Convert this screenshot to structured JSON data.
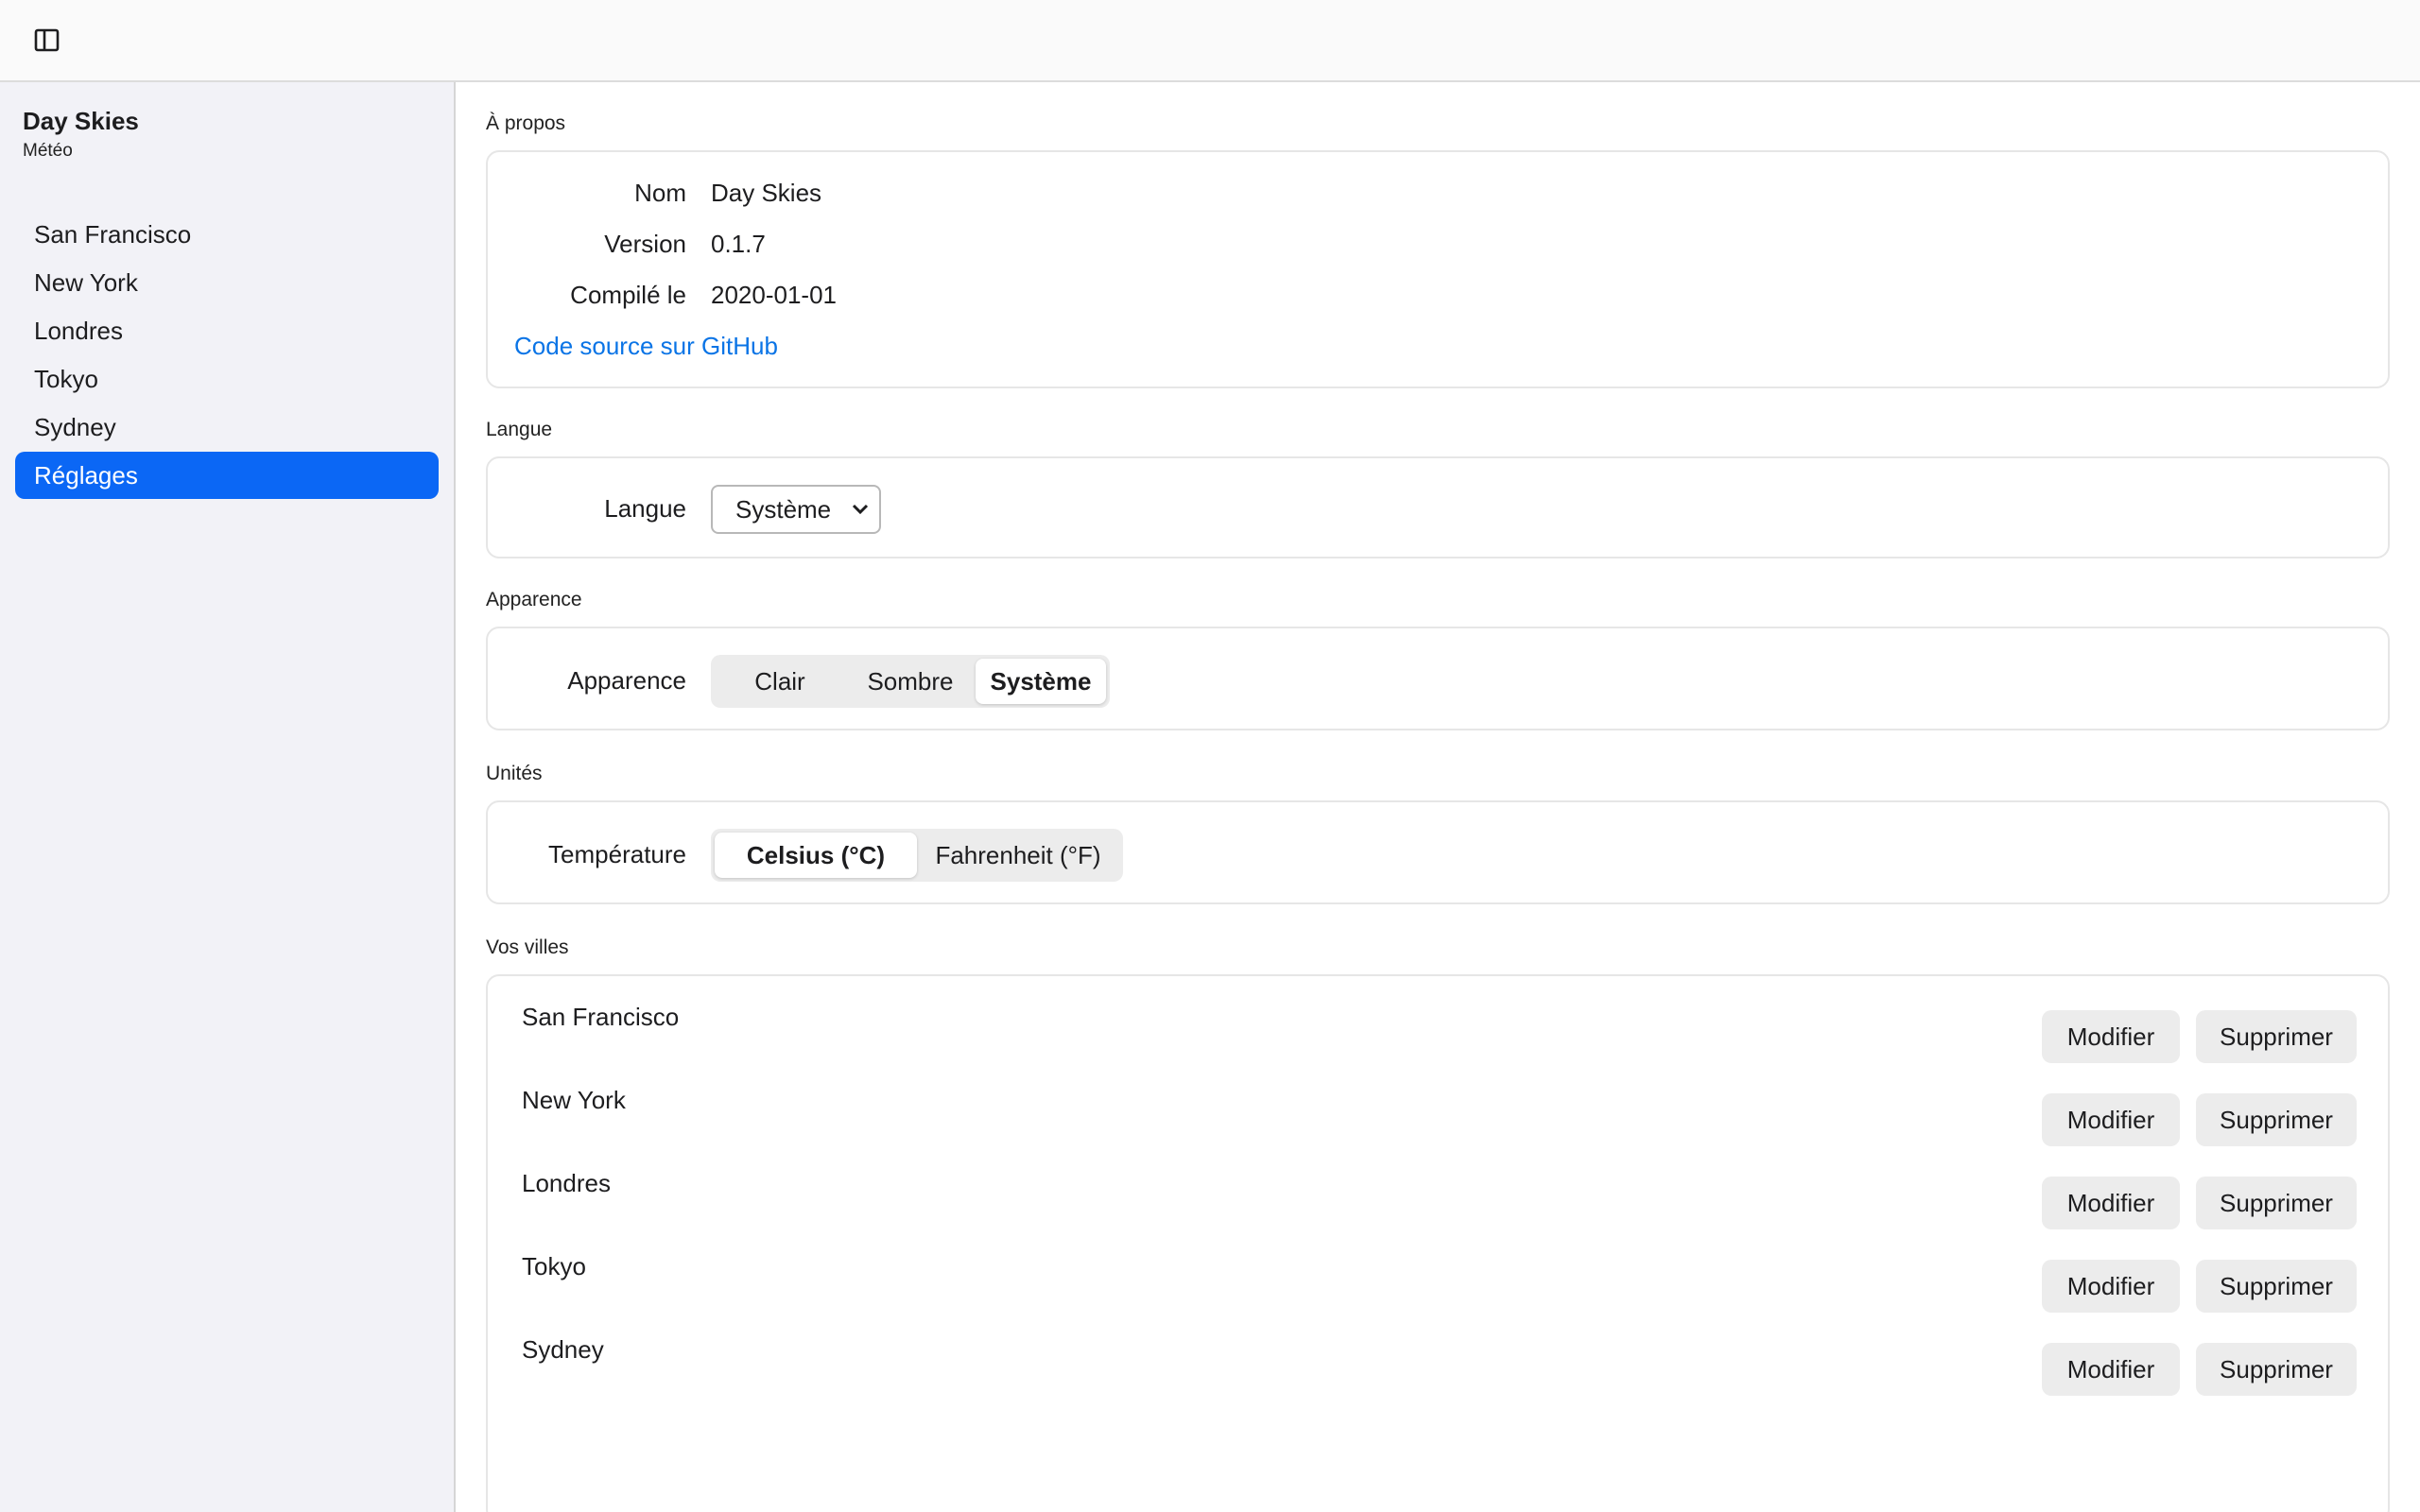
{
  "sidebar": {
    "app_title": "Day Skies",
    "app_subtitle": "Météo",
    "items": [
      {
        "label": "San Francisco"
      },
      {
        "label": "New York"
      },
      {
        "label": "Londres"
      },
      {
        "label": "Tokyo"
      },
      {
        "label": "Sydney"
      },
      {
        "label": "Réglages",
        "active": true
      }
    ]
  },
  "about": {
    "section_label": "À propos",
    "name_label": "Nom",
    "name_value": "Day Skies",
    "version_label": "Version",
    "version_value": "0.1.7",
    "compiled_label": "Compilé le",
    "compiled_value": "2020-01-01",
    "source_link": "Code source sur GitHub"
  },
  "language": {
    "section_label": "Langue",
    "row_label": "Langue",
    "selected": "Système"
  },
  "appearance": {
    "section_label": "Apparence",
    "row_label": "Apparence",
    "options": [
      "Clair",
      "Sombre",
      "Système"
    ],
    "selected": "Système"
  },
  "units": {
    "section_label": "Unités",
    "row_label": "Température",
    "options": [
      "Celsius (°C)",
      "Fahrenheit (°F)"
    ],
    "selected": "Celsius (°C)"
  },
  "cities": {
    "section_label": "Vos villes",
    "edit_label": "Modifier",
    "delete_label": "Supprimer",
    "items": [
      "San Francisco",
      "New York",
      "Londres",
      "Tokyo",
      "Sydney"
    ]
  },
  "colors": {
    "accent": "#0b67f5",
    "link": "#0a74e6",
    "sidebar_bg": "#f2f2f7"
  },
  "icons": {
    "sidebar_toggle": "sidebar-toggle-icon"
  }
}
